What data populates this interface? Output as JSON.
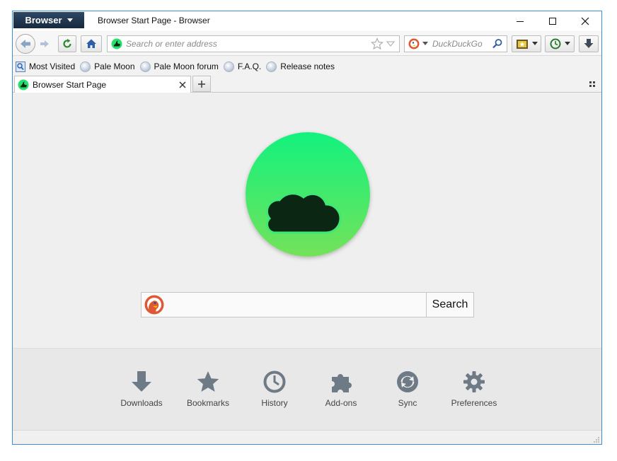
{
  "window": {
    "app_menu_label": "Browser",
    "title": "Browser Start Page - Browser"
  },
  "navbar": {
    "url_placeholder": "Search or enter address",
    "search_engine": "DuckDuckGo",
    "search_placeholder": "DuckDuckGo"
  },
  "bookmarks": [
    {
      "label": "Most Visited",
      "icon": "most-visited-icon"
    },
    {
      "label": "Pale Moon",
      "icon": "globe-icon"
    },
    {
      "label": "Pale Moon forum",
      "icon": "globe-icon"
    },
    {
      "label": "F.A.Q.",
      "icon": "globe-icon"
    },
    {
      "label": "Release notes",
      "icon": "globe-icon"
    }
  ],
  "tabs": [
    {
      "label": "Browser Start Page",
      "active": true
    }
  ],
  "start_page": {
    "search_value": "",
    "search_button": "Search",
    "launcher": [
      {
        "label": "Downloads",
        "icon": "download-icon"
      },
      {
        "label": "Bookmarks",
        "icon": "star-icon"
      },
      {
        "label": "History",
        "icon": "clock-icon"
      },
      {
        "label": "Add-ons",
        "icon": "puzzle-icon"
      },
      {
        "label": "Sync",
        "icon": "sync-icon"
      },
      {
        "label": "Preferences",
        "icon": "gear-icon"
      }
    ]
  },
  "colors": {
    "accent": "#3c8fd6",
    "app_menu": "#1e3550",
    "logo_top": "#12f27e",
    "logo_bottom": "#74e25a",
    "logo_glyph": "#0c2614",
    "launcher_icon": "#6e7a86"
  }
}
